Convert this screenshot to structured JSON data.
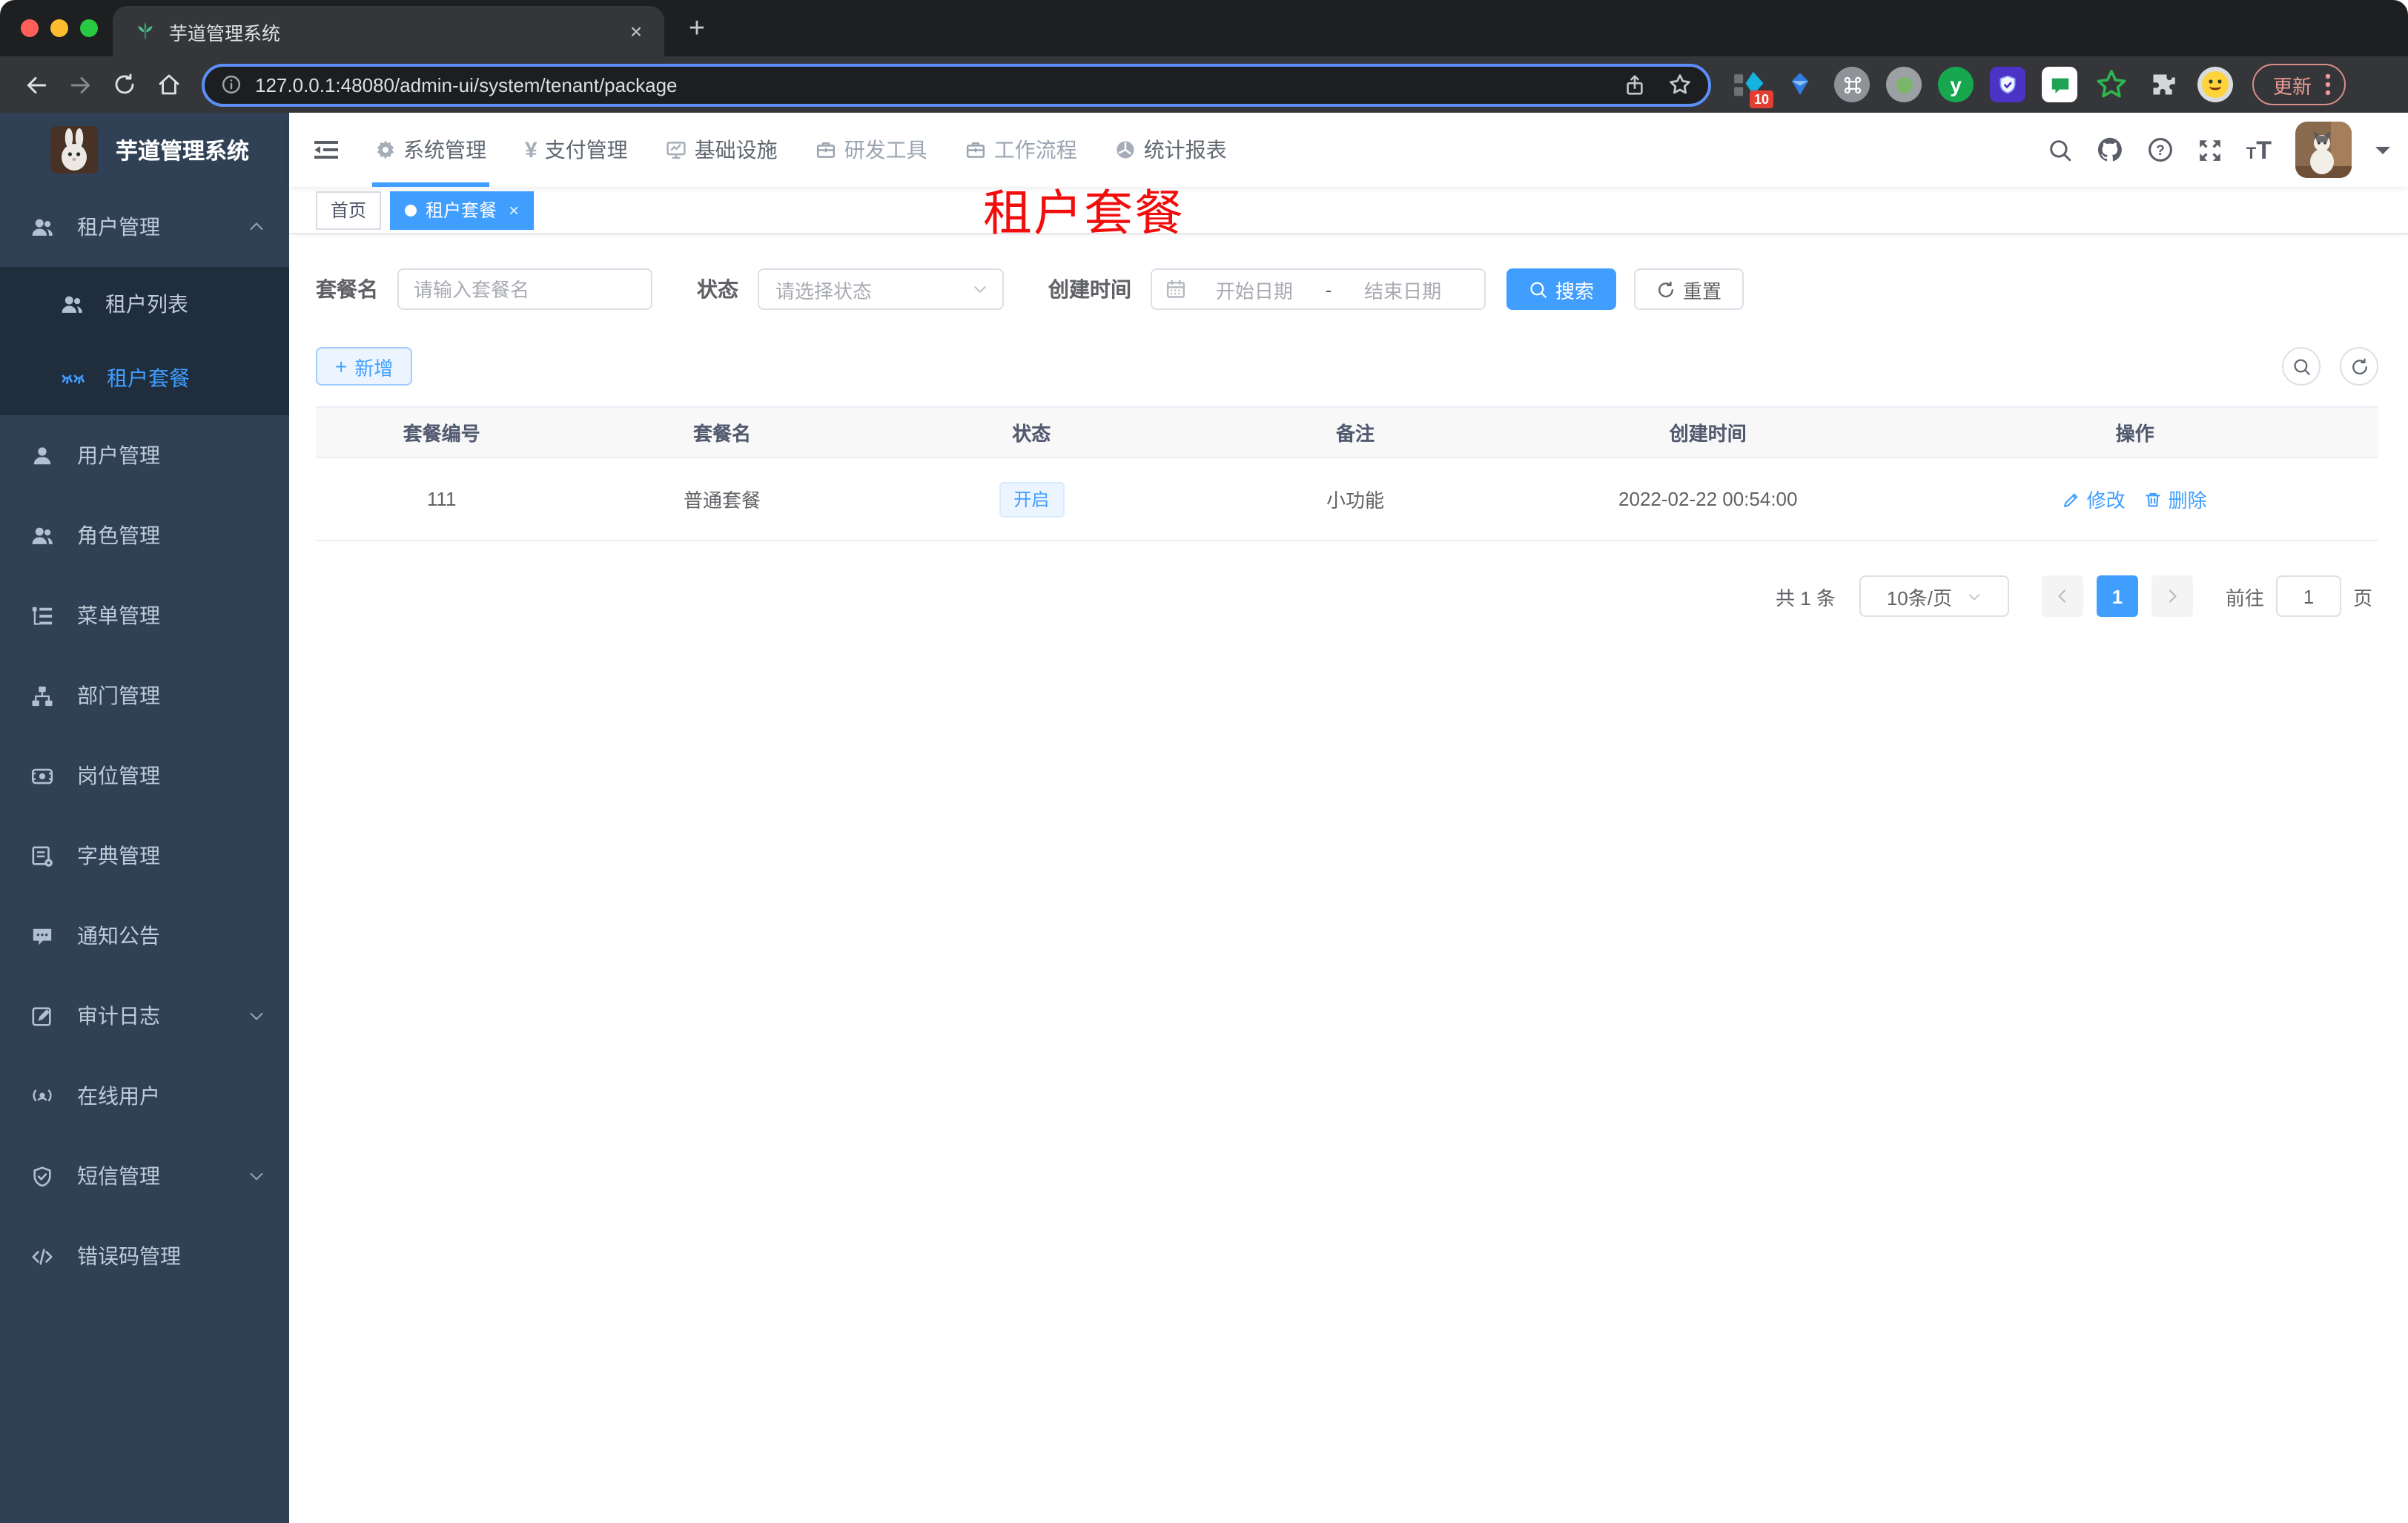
{
  "colors": {
    "accent": "#409eff",
    "overlay_red": "#f20d0d",
    "sidebar_bg": "#304156",
    "submenu_bg": "#1f2d3d",
    "status_tag_bg": "#ecf5ff"
  },
  "icons": {
    "close": "×",
    "plus": "+",
    "yen": "¥",
    "question": "?",
    "font_large": "T",
    "font_small": "T",
    "ext_letter": "y"
  },
  "browser": {
    "tab_title": "芋道管理系统",
    "url": "127.0.0.1:48080/admin-ui/system/tenant/package",
    "update_label": "更新",
    "ext_badge": "10"
  },
  "app": {
    "logo_title": "芋道管理系统",
    "nav": [
      {
        "label": "系统管理"
      },
      {
        "label": "支付管理"
      },
      {
        "label": "基础设施"
      },
      {
        "label": "研发工具"
      },
      {
        "label": "工作流程"
      },
      {
        "label": "统计报表"
      }
    ],
    "sidebar": [
      {
        "label": "租户管理"
      },
      {
        "label": "租户列表"
      },
      {
        "label": "租户套餐"
      },
      {
        "label": "用户管理"
      },
      {
        "label": "角色管理"
      },
      {
        "label": "菜单管理"
      },
      {
        "label": "部门管理"
      },
      {
        "label": "岗位管理"
      },
      {
        "label": "字典管理"
      },
      {
        "label": "通知公告"
      },
      {
        "label": "审计日志"
      },
      {
        "label": "在线用户"
      },
      {
        "label": "短信管理"
      },
      {
        "label": "错误码管理"
      }
    ],
    "tags": {
      "home": "首页",
      "active": "租户套餐"
    },
    "overlay_title": "租户套餐",
    "filters": {
      "name_label": "套餐名",
      "name_placeholder": "请输入套餐名",
      "status_label": "状态",
      "status_placeholder": "请选择状态",
      "time_label": "创建时间",
      "start_placeholder": "开始日期",
      "range_separator": "-",
      "end_placeholder": "结束日期",
      "search_label": "搜索",
      "reset_label": "重置"
    },
    "toolbar": {
      "add_label": "新增"
    },
    "table": {
      "headers": [
        "套餐编号",
        "套餐名",
        "状态",
        "备注",
        "创建时间",
        "操作"
      ],
      "row": {
        "id": "111",
        "name": "普通套餐",
        "status": "开启",
        "remark": "小功能",
        "created_at": "2022-02-22 00:54:00",
        "edit_label": "修改",
        "delete_label": "删除"
      }
    },
    "pagination": {
      "total": "共 1 条",
      "page_size": "10条/页",
      "current_page": "1",
      "goto_label": "前往",
      "goto_value": "1",
      "page_unit": "页"
    }
  }
}
